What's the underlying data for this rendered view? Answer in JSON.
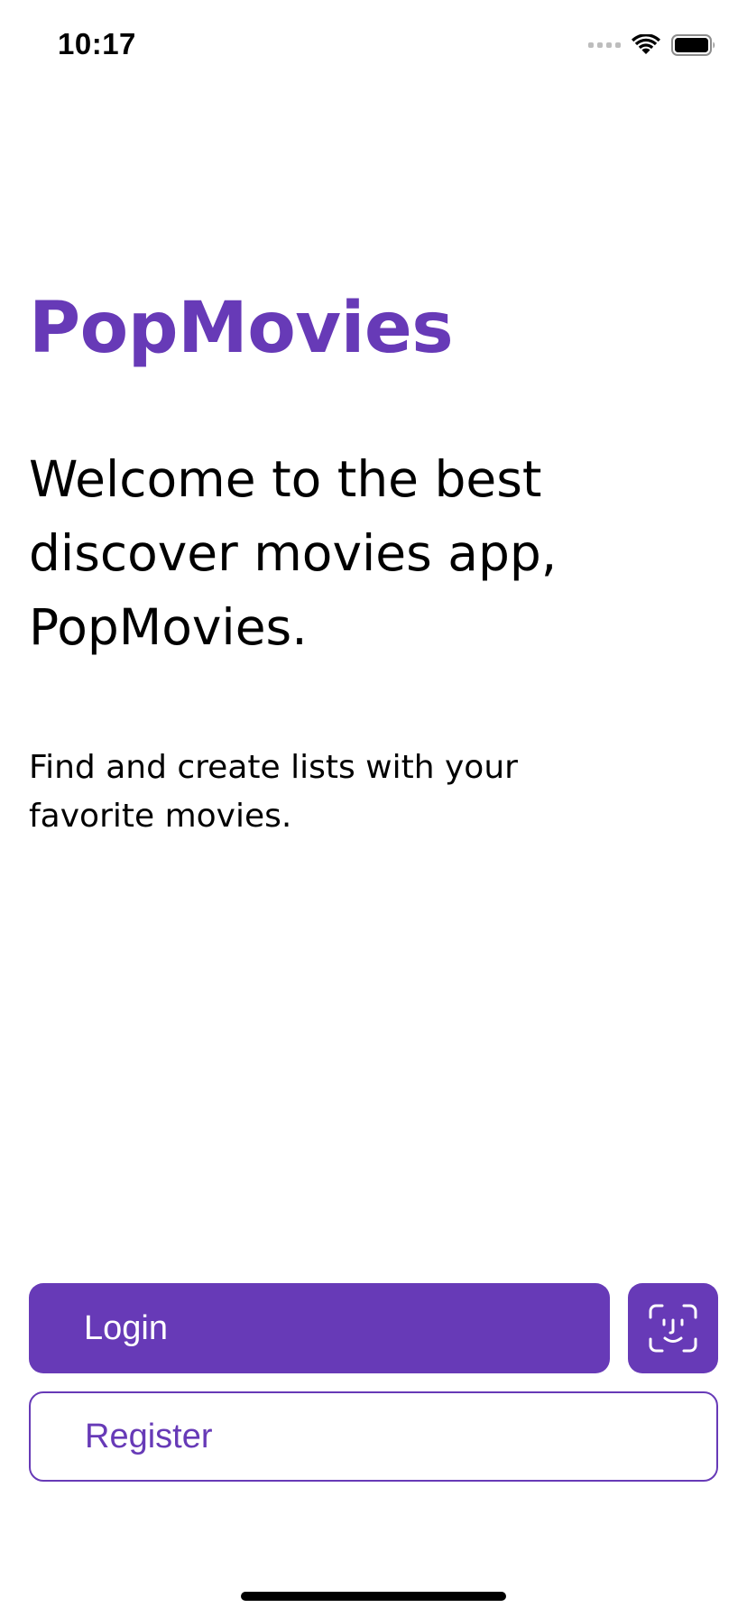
{
  "status_bar": {
    "time": "10:17",
    "icons": [
      "signal-icon",
      "wifi-icon",
      "battery-icon"
    ]
  },
  "hero": {
    "app_title": "PopMovies",
    "welcome": "Welcome to the best discover movies app, PopMovies.",
    "tagline": "Find and create lists with your favorite movies."
  },
  "actions": {
    "login_label": "Login",
    "faceid_icon": "face-id-icon",
    "register_label": "Register"
  },
  "colors": {
    "accent": "#673AB7",
    "background": "#FFFFFF",
    "text": "#000000"
  }
}
